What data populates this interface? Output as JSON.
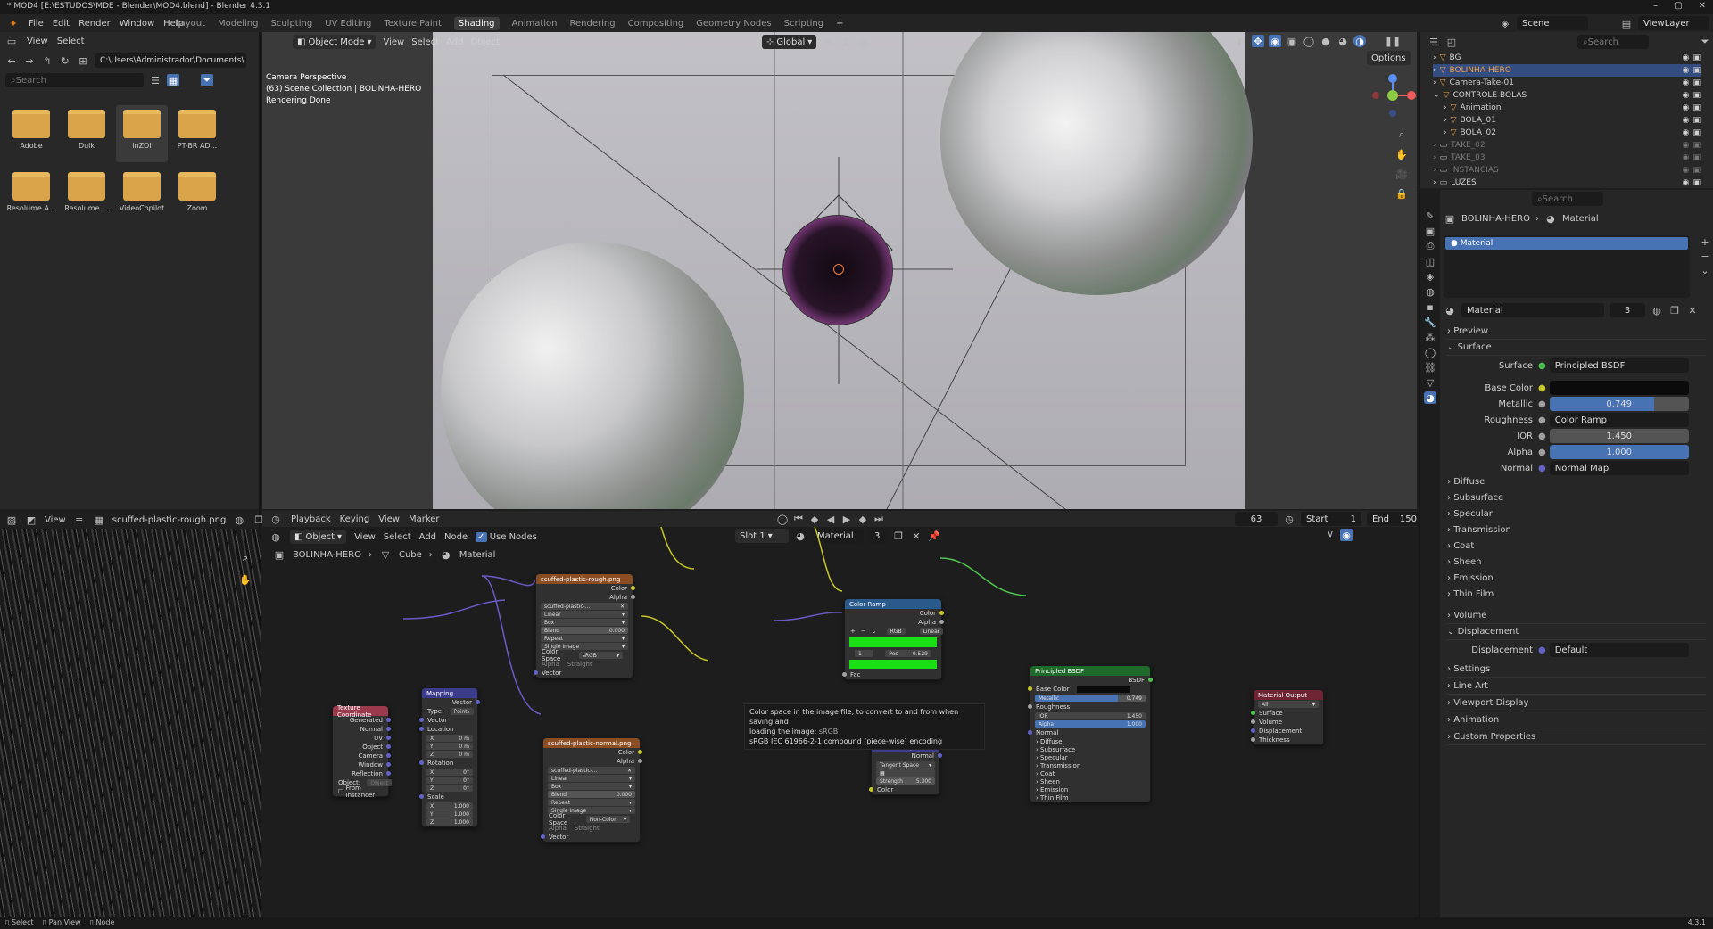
{
  "window": {
    "title": "* MOD4 [E:\\ESTUDOS\\MDE - Blender\\MOD4.blend] - Blender 4.3.1"
  },
  "menu": [
    "File",
    "Edit",
    "Render",
    "Window",
    "Help"
  ],
  "workspaces": [
    "Layout",
    "Modeling",
    "Sculpting",
    "UV Editing",
    "Texture Paint",
    "Shading",
    "Animation",
    "Rendering",
    "Compositing",
    "Geometry Nodes",
    "Scripting"
  ],
  "workspace_add": "+",
  "active_workspace": "Shading",
  "scene": {
    "name": "Scene",
    "view_layer": "ViewLayer"
  },
  "file_browser": {
    "menu": [
      "View",
      "Select"
    ],
    "path": "C:\\Users\\Administrador\\Documents\\",
    "search_placeholder": "Search",
    "folders": [
      "Adobe",
      "Dulk",
      "inZOI",
      "PT-BR AD...",
      "Resolume A...",
      "Resolume ...",
      "VideoCopilot",
      "Zoom"
    ]
  },
  "viewport": {
    "mode": "Object Mode",
    "menu": [
      "View",
      "Select",
      "Add",
      "Object"
    ],
    "transform": "Global",
    "options": "Options",
    "info_lines": [
      "Camera Perspective",
      "(63) Scene Collection | BOLINHA-HERO",
      "Rendering Done"
    ]
  },
  "image_editor": {
    "menu": [
      "View"
    ],
    "image_name": "scuffed-plastic-rough.png"
  },
  "timeline": {
    "menu": [
      "Playback",
      "Keying",
      "View",
      "Marker"
    ],
    "frame": "63",
    "start_label": "Start",
    "start": "1",
    "end_label": "End",
    "end": "150"
  },
  "node_editor": {
    "object": "Object",
    "menu": [
      "View",
      "Select",
      "Add",
      "Node"
    ],
    "use_nodes": "Use Nodes",
    "slot": "Slot 1",
    "material": "Material",
    "users": "3",
    "breadcrumb": [
      "BOLINHA-HERO",
      "Cube",
      "Material"
    ],
    "tooltip": [
      "Color space in the image file, to convert to and from when saving and",
      "loading the image:",
      "sRGB",
      "sRGB IEC 61966-2-1 compound (piece-wise) encoding"
    ]
  },
  "nodes": {
    "texcoord": {
      "title": "Texture Coordinate",
      "outputs": [
        "Generated",
        "Normal",
        "UV",
        "Object",
        "Camera",
        "Window",
        "Reflection"
      ],
      "object_label": "Object:",
      "object_ph": "Object",
      "from_instancer": "From Instancer"
    },
    "mapping": {
      "title": "Mapping",
      "out": "Vector",
      "type_label": "Type:",
      "type": "Point",
      "inputs": [
        "Vector",
        "Location",
        "Rotation",
        "Scale"
      ],
      "loc": [
        "0 m",
        "0 m",
        "0 m"
      ],
      "rot": [
        "0°",
        "0°",
        "0°"
      ],
      "scale": [
        "1.000",
        "1.000",
        "1.000"
      ],
      "axes": [
        "X",
        "Y",
        "Z"
      ]
    },
    "img_rough": {
      "title": "scuffed-plastic-rough.png",
      "outs": [
        "Color",
        "Alpha"
      ],
      "file": "scuffed-plastic-...",
      "interp": "Linear",
      "proj": "Box",
      "blend_label": "Blend",
      "blend": "0.000",
      "ext": "Repeat",
      "src": "Single Image",
      "cs_label": "Color Space",
      "cs": "sRGB",
      "alpha_label": "Alpha",
      "alpha": "Straight",
      "vec": "Vector"
    },
    "img_normal": {
      "title": "scuffed-plastic-normal.png",
      "outs": [
        "Color",
        "Alpha"
      ],
      "file": "scuffed-plastic-...",
      "interp": "Linear",
      "proj": "Box",
      "blend_label": "Blend",
      "blend": "0.000",
      "ext": "Repeat",
      "src": "Single Image",
      "cs_label": "Color Space",
      "cs": "Non-Color",
      "alpha_label": "Alpha",
      "alpha": "Straight",
      "vec": "Vector"
    },
    "ramp": {
      "title": "Color Ramp",
      "outs": [
        "Color",
        "Alpha"
      ],
      "mode": "RGB",
      "interp": "Linear",
      "index": "1",
      "pos_label": "Pos",
      "pos": "0.529",
      "fac": "Fac"
    },
    "normalmap": {
      "title": "Normal Map",
      "out": "Normal",
      "space": "Tangent Space",
      "strength_label": "Strength",
      "strength": "5.300",
      "color": "Color"
    },
    "bsdf": {
      "title": "Principled BSDF",
      "out": "BSDF",
      "rows": [
        "Base Color",
        "Metallic",
        "Roughness",
        "IOR",
        "Alpha",
        "Normal"
      ],
      "metallic": "0.749",
      "ior": "1.450",
      "alpha": "1.000",
      "subs": [
        "Diffuse",
        "Subsurface",
        "Specular",
        "Transmission",
        "Coat",
        "Sheen",
        "Emission",
        "Thin Film"
      ]
    },
    "output": {
      "title": "Material Output",
      "target": "All",
      "inputs": [
        "Surface",
        "Volume",
        "Displacement",
        "Thickness"
      ]
    }
  },
  "outliner": {
    "search_placeholder": "Search",
    "items": [
      "BG",
      "BOLINHA-HERO",
      "Camera-Take-01",
      "CONTROLE-BOLAS",
      "Animation",
      "BOLA_01",
      "BOLA_02",
      "TAKE_02",
      "TAKE_03",
      "INSTANCIAS",
      "LUZES"
    ]
  },
  "properties": {
    "search_placeholder": "Search",
    "breadcrumb": [
      "BOLINHA-HERO",
      "Material"
    ],
    "slot": "Material",
    "mat_name": "Material",
    "users": "3",
    "sections": [
      "Preview",
      "Surface"
    ],
    "surface_label": "Surface",
    "surface": "Principled BSDF",
    "base_color_label": "Base Color",
    "metallic_label": "Metallic",
    "metallic": "0.749",
    "roughness_label": "Roughness",
    "roughness": "Color Ramp",
    "ior_label": "IOR",
    "ior": "1.450",
    "alpha_label": "Alpha",
    "alpha": "1.000",
    "normal_label": "Normal",
    "normal": "Normal Map",
    "subs": [
      "Diffuse",
      "Subsurface",
      "Specular",
      "Transmission",
      "Coat",
      "Sheen",
      "Emission",
      "Thin Film"
    ],
    "volume": "Volume",
    "displacement": "Displacement",
    "disp_label": "Displacement",
    "disp": "Default",
    "more": [
      "Settings",
      "Line Art",
      "Viewport Display",
      "Animation",
      "Custom Properties"
    ]
  },
  "status": {
    "items": [
      "Select",
      "Pan View",
      "Node"
    ],
    "version": "4.3.1"
  },
  "colors": {
    "accent": "#4772b3",
    "selected_row": "#334d80",
    "green_ramp": "#18e014",
    "image_node": "#8a4e22",
    "texcoord_node": "#9b3a4d",
    "vector_node": "#3c3c8c",
    "bsdf_node": "#1e6a2a",
    "output_node": "#6e2433",
    "ramp_node": "#2a5a8c"
  }
}
